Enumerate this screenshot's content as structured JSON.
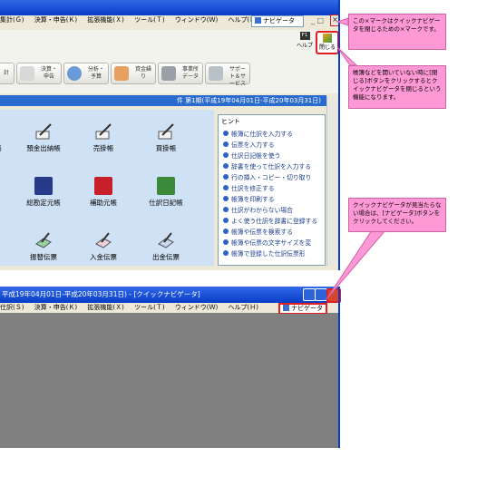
{
  "window_main": {
    "title": "平成19年04月01日-平成20年03月31日)",
    "menu": [
      "集計(Ｇ)",
      "決算・申告(Ｋ)",
      "拡張機能(Ｘ)",
      "ツール(Ｔ)",
      "ウィンドウ(Ｗ)",
      "ヘルプ(Ｈ)"
    ],
    "navi_label": "ナビゲータ",
    "close_label": "閉じる",
    "help_label": "ヘルプ",
    "help_key": "F1",
    "toolbar": [
      "計",
      "決算・申告",
      "分析・予算",
      "資金繰り",
      "事業所データ",
      "サポート＆サービス"
    ],
    "period": "件 第1期(平成19年04月01日-平成20年03月31日)"
  },
  "books": [
    {
      "label": "帳",
      "icon": "book-partial-icon"
    },
    {
      "label": "預金出納帳",
      "icon": "pen-book-icon"
    },
    {
      "label": "売掛帳",
      "icon": "pen-book-icon"
    },
    {
      "label": "買掛帳",
      "icon": "pen-book-icon"
    },
    {
      "label": "総勘定元帳",
      "icon": "blue-ledger-icon"
    },
    {
      "label": "補助元帳",
      "icon": "red-ledger-icon"
    },
    {
      "label": "仕訳日記帳",
      "icon": "green-ledger-icon"
    },
    {
      "label": "振替伝票",
      "icon": "slip-icon"
    },
    {
      "label": "入金伝票",
      "icon": "slip-icon"
    },
    {
      "label": "出金伝票",
      "icon": "slip-icon"
    }
  ],
  "hint": {
    "title": "ヒント",
    "items": [
      "帳簿に仕訳を入力する",
      "伝票を入力する",
      "仕訳日記帳を使う",
      "辞書を使って仕訳を入力する",
      "行の挿入・コピー・切り取り",
      "仕訳を修正する",
      "帳簿を印刷する",
      "仕訳がわからない場合",
      "よく使う仕訳を辞書に登録する",
      "帳簿や伝票を検索する",
      "帳簿や伝票の文字サイズを変",
      "帳簿で登録した仕訳伝票形"
    ]
  },
  "window_second": {
    "title": "平成19年04月01日-平成20年03月31日) - [クイックナビゲータ]",
    "menu": [
      "仕訳(Ｓ)",
      "決算・申告(Ｋ)",
      "拡張機能(Ｘ)",
      "ツール(Ｔ)",
      "ウィンドウ(Ｗ)",
      "ヘルプ(Ｈ)"
    ],
    "navi_label": "ナビゲータ"
  },
  "callouts": [
    "この×マークはクイックナビゲータを閉じるための×マークです。",
    "帳簿などを開いていない時に[閉じる]ボタンをクリックするとクイックナビゲータを閉じるという機能になります。",
    "クイックナビゲータが見当たらない場合は、[ナビゲータ]ボタンをクリックしてください。"
  ],
  "colors": {
    "accent": "#ff99d6",
    "highlight": "#e02020",
    "title_blue": "#0a3cc8"
  }
}
